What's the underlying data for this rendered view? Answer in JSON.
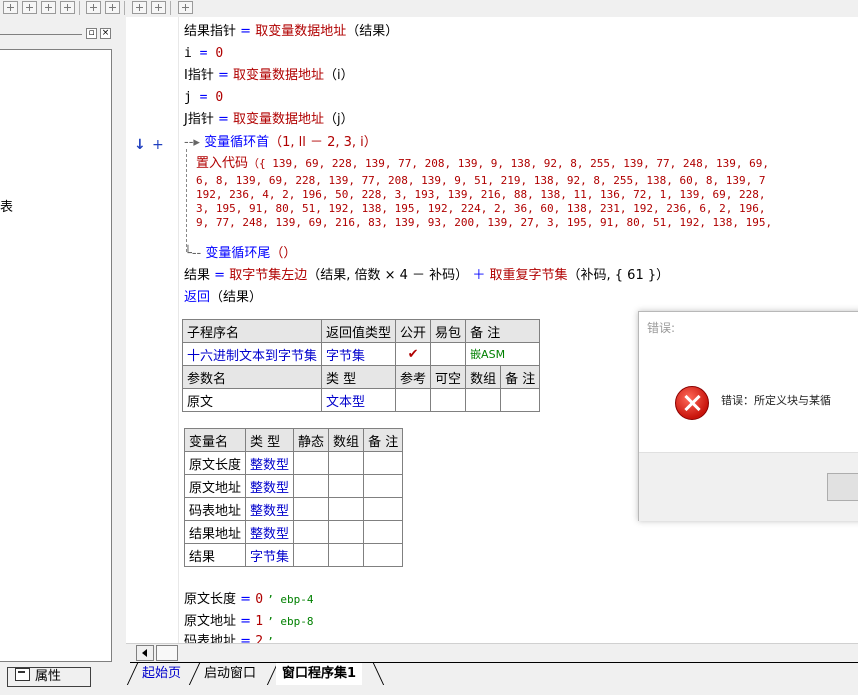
{
  "editor": {
    "lines": [
      {
        "var": "结果指针",
        "op": "=",
        "fn": "取变量数据地址",
        "arg": "（结果）"
      },
      {
        "var": "i",
        "op": "=",
        "num": "0"
      },
      {
        "var": "I指针",
        "op": "=",
        "fn": "取变量数据地址",
        "arg": "（i）"
      },
      {
        "var": "j",
        "op": "=",
        "num": "0"
      },
      {
        "var": "J指针",
        "op": "=",
        "fn": "取变量数据地址",
        "arg": "（j）"
      }
    ],
    "loop_start": {
      "fn": "变量循环首",
      "args": "（1, ll － 2, 3, i）"
    },
    "asm": {
      "fn": "置入代码",
      "line1": "（{ 139, 69, 228, 139, 77, 208, 139, 9, 138, 92, 8, 255, 139, 77, 248, 139, 69,",
      "line2": "6, 8, 139, 69, 228, 139, 77, 208, 139, 9, 51, 219, 138, 92, 8, 255, 138, 60, 8, 139, 7",
      "line3": "192, 236, 4, 2, 196, 50, 228, 3, 193, 139, 216, 88, 138, 11, 136, 72, 1, 139, 69, 228,",
      "line4": "3, 195, 91, 80, 51, 192, 138, 195, 192, 224, 2, 36, 60, 138, 231, 192, 236, 6, 2, 196,",
      "line5": "9, 77, 248, 139, 69, 216, 83, 139, 93, 200, 139, 27, 3, 195, 91, 80, 51, 192, 138, 195,"
    },
    "loop_end": {
      "fn": "变量循环尾",
      "args": "（）"
    },
    "result_line": {
      "var": "结果",
      "op": "=",
      "fn1": "取字节集左边",
      "arg1": "（结果, 倍数 × 4 － 补码）",
      "plus": "＋",
      "fn2": "取重复字节集",
      "arg2": "（补码, { 61 }）"
    },
    "return_line": {
      "fn": "返回",
      "arg": "（结果）"
    },
    "sub_table": {
      "headers": [
        "子程序名",
        "返回值类型",
        "公开",
        "易包",
        "备 注"
      ],
      "row": {
        "name": "十六进制文本到字节集",
        "type": "字节集",
        "public": "✔",
        "pkg": "",
        "note": "嵌ASM"
      },
      "param_headers": [
        "参数名",
        "类 型",
        "参考",
        "可空",
        "数组",
        "备 注"
      ],
      "params": [
        {
          "name": "原文",
          "type": "文本型"
        }
      ]
    },
    "var_table": {
      "headers": [
        "变量名",
        "类 型",
        "静态",
        "数组",
        "备 注"
      ],
      "rows": [
        {
          "name": "原文长度",
          "type": "整数型"
        },
        {
          "name": "原文地址",
          "type": "整数型"
        },
        {
          "name": "码表地址",
          "type": "整数型"
        },
        {
          "name": "结果地址",
          "type": "整数型"
        },
        {
          "name": "结果",
          "type": "字节集"
        }
      ]
    },
    "tail_lines": [
      {
        "var": "原文长度",
        "op": "=",
        "num": "0",
        "comment": "’ ebp-4"
      },
      {
        "var": "原文地址",
        "op": "=",
        "num": "1",
        "comment": "’ ebp-8"
      },
      {
        "var": "码表地址",
        "op": "=",
        "num": "2",
        "comment": "’ ..."
      }
    ]
  },
  "left_panel": {
    "fragment": "表"
  },
  "property_button": "属性",
  "tabs": [
    "起始页",
    "启动窗口",
    "窗口程序集1"
  ],
  "dialog": {
    "title": "错误:",
    "message": "错误：所定义块与某循"
  },
  "colors": {
    "keyword": "#0000ff",
    "function": "#b00000",
    "number": "#008000",
    "error": "#c8140c"
  }
}
